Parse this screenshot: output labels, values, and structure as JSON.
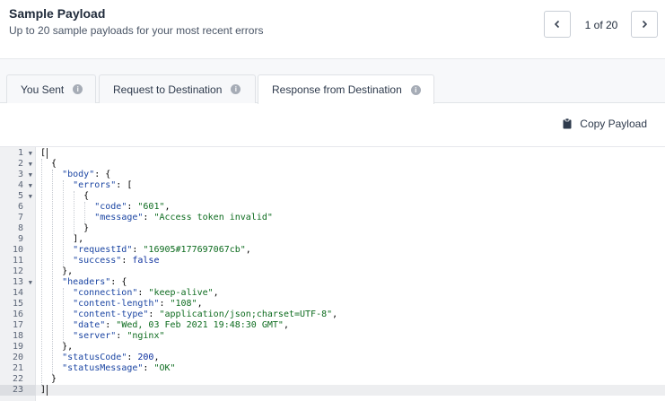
{
  "header": {
    "title": "Sample Payload",
    "subtitle": "Up to 20 sample payloads for your most recent errors",
    "pager": "1 of 20",
    "prev_icon": "chevron-left-icon",
    "next_icon": "chevron-right-icon"
  },
  "tabs": [
    {
      "label": "You Sent",
      "icon": "info-icon",
      "active": false
    },
    {
      "label": "Request to Destination",
      "icon": "info-icon",
      "active": false
    },
    {
      "label": "Response from Destination",
      "icon": "info-icon",
      "active": true
    }
  ],
  "toolbar": {
    "copy_label": "Copy Payload",
    "copy_icon": "clipboard-icon"
  },
  "editor": {
    "active_line": 23,
    "lines": [
      {
        "n": "1",
        "fold": true,
        "text": "["
      },
      {
        "n": "2",
        "fold": true,
        "text": "  {"
      },
      {
        "n": "3",
        "fold": true,
        "text": "    \"body\": {"
      },
      {
        "n": "4",
        "fold": true,
        "text": "      \"errors\": ["
      },
      {
        "n": "5",
        "fold": true,
        "text": "        {"
      },
      {
        "n": "6",
        "fold": false,
        "text": "          \"code\": \"601\","
      },
      {
        "n": "7",
        "fold": false,
        "text": "          \"message\": \"Access token invalid\""
      },
      {
        "n": "8",
        "fold": false,
        "text": "        }"
      },
      {
        "n": "9",
        "fold": false,
        "text": "      ],"
      },
      {
        "n": "10",
        "fold": false,
        "text": "      \"requestId\": \"16905#177697067cb\","
      },
      {
        "n": "11",
        "fold": false,
        "text": "      \"success\": false"
      },
      {
        "n": "12",
        "fold": false,
        "text": "    },"
      },
      {
        "n": "13",
        "fold": true,
        "text": "    \"headers\": {"
      },
      {
        "n": "14",
        "fold": false,
        "text": "      \"connection\": \"keep-alive\","
      },
      {
        "n": "15",
        "fold": false,
        "text": "      \"content-length\": \"108\","
      },
      {
        "n": "16",
        "fold": false,
        "text": "      \"content-type\": \"application/json;charset=UTF-8\","
      },
      {
        "n": "17",
        "fold": false,
        "text": "      \"date\": \"Wed, 03 Feb 2021 19:48:30 GMT\","
      },
      {
        "n": "18",
        "fold": false,
        "text": "      \"server\": \"nginx\""
      },
      {
        "n": "19",
        "fold": false,
        "text": "    },"
      },
      {
        "n": "20",
        "fold": false,
        "text": "    \"statusCode\": 200,"
      },
      {
        "n": "21",
        "fold": false,
        "text": "    \"statusMessage\": \"OK\""
      },
      {
        "n": "22",
        "fold": false,
        "text": "  }"
      },
      {
        "n": "23",
        "fold": false,
        "text": "]"
      }
    ]
  }
}
